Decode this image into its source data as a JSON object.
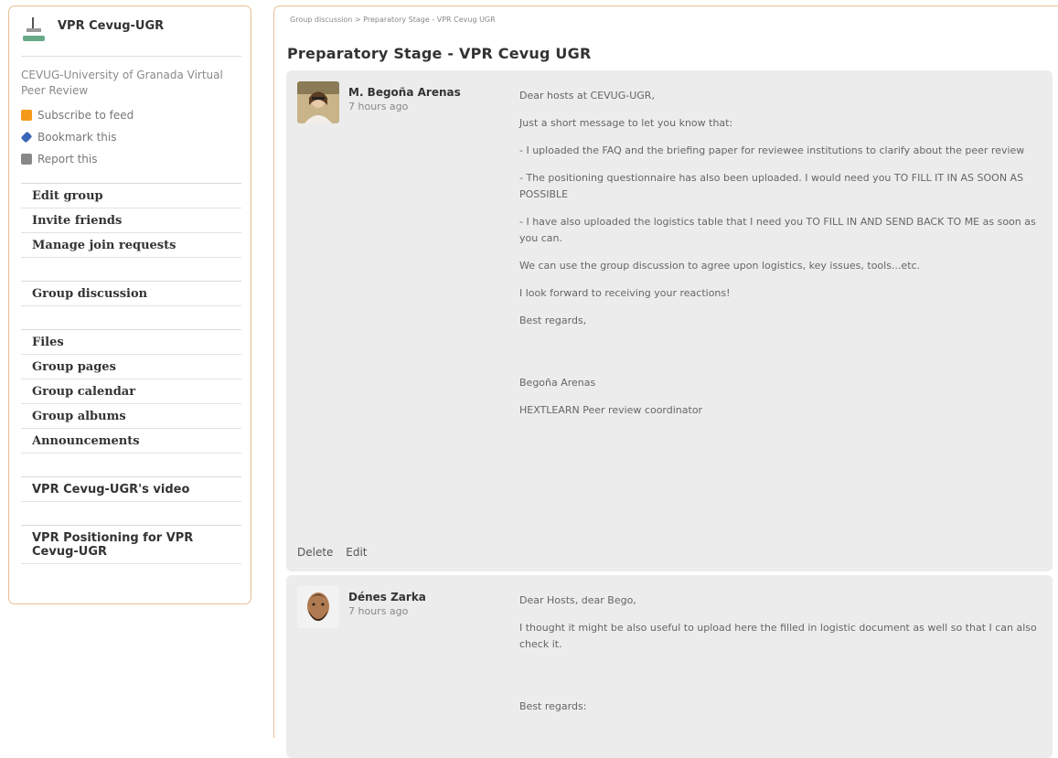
{
  "sidebar": {
    "group_title": "VPR Cevug-UGR",
    "group_description": "CEVUG-University of Granada Virtual Peer Review",
    "tools": [
      {
        "label": "Subscribe to feed",
        "icon": "feed-icon"
      },
      {
        "label": "Bookmark this",
        "icon": "bookmark-icon"
      },
      {
        "label": "Report this",
        "icon": "report-icon"
      }
    ],
    "menu": {
      "edit_group": "Edit group",
      "invite_friends": "Invite friends",
      "manage_join_requests": "Manage join requests",
      "group_discussion": "Group discussion",
      "files": "Files",
      "group_pages": "Group pages",
      "group_calendar": "Group calendar",
      "group_albums": "Group albums",
      "announcements": "Announcements",
      "video": "VPR Cevug-UGR's video",
      "positioning": "VPR Positioning for VPR Cevug-UGR"
    }
  },
  "breadcrumb": {
    "item1": "Group discussion",
    "separator": ">",
    "item2": "Preparatory Stage - VPR Cevug UGR"
  },
  "page_title": "Preparatory Stage - VPR Cevug UGR",
  "posts": [
    {
      "author": "M. Begoña Arenas",
      "time": "7 hours ago",
      "paragraphs": [
        "Dear hosts at CEVUG-UGR,",
        "Just a short message to let you know that:",
        "- I uploaded the FAQ and the briefing paper for reviewee institutions to clarify about the peer review",
        "- The positioning questionnaire has also been uploaded. I would need you TO FILL IT IN AS SOON AS POSSIBLE",
        "- I have also uploaded the logistics table that I need you TO FILL IN AND SEND BACK TO ME as soon as you can.",
        "We can use the group discussion to agree upon logistics, key issues, tools...etc.",
        "I look forward to receiving your reactions!",
        "Best regards,",
        "",
        "Begoña Arenas",
        "HEXTLEARN Peer review coordinator"
      ],
      "actions": {
        "delete": "Delete",
        "edit": "Edit"
      }
    },
    {
      "author": "Dénes Zarka",
      "time": "7 hours ago",
      "paragraphs": [
        "Dear Hosts, dear Bego,",
        "I thought it might be also useful to upload here the filled in logistic document as well so  that I can also check it.",
        "",
        "Best regards:"
      ]
    }
  ]
}
